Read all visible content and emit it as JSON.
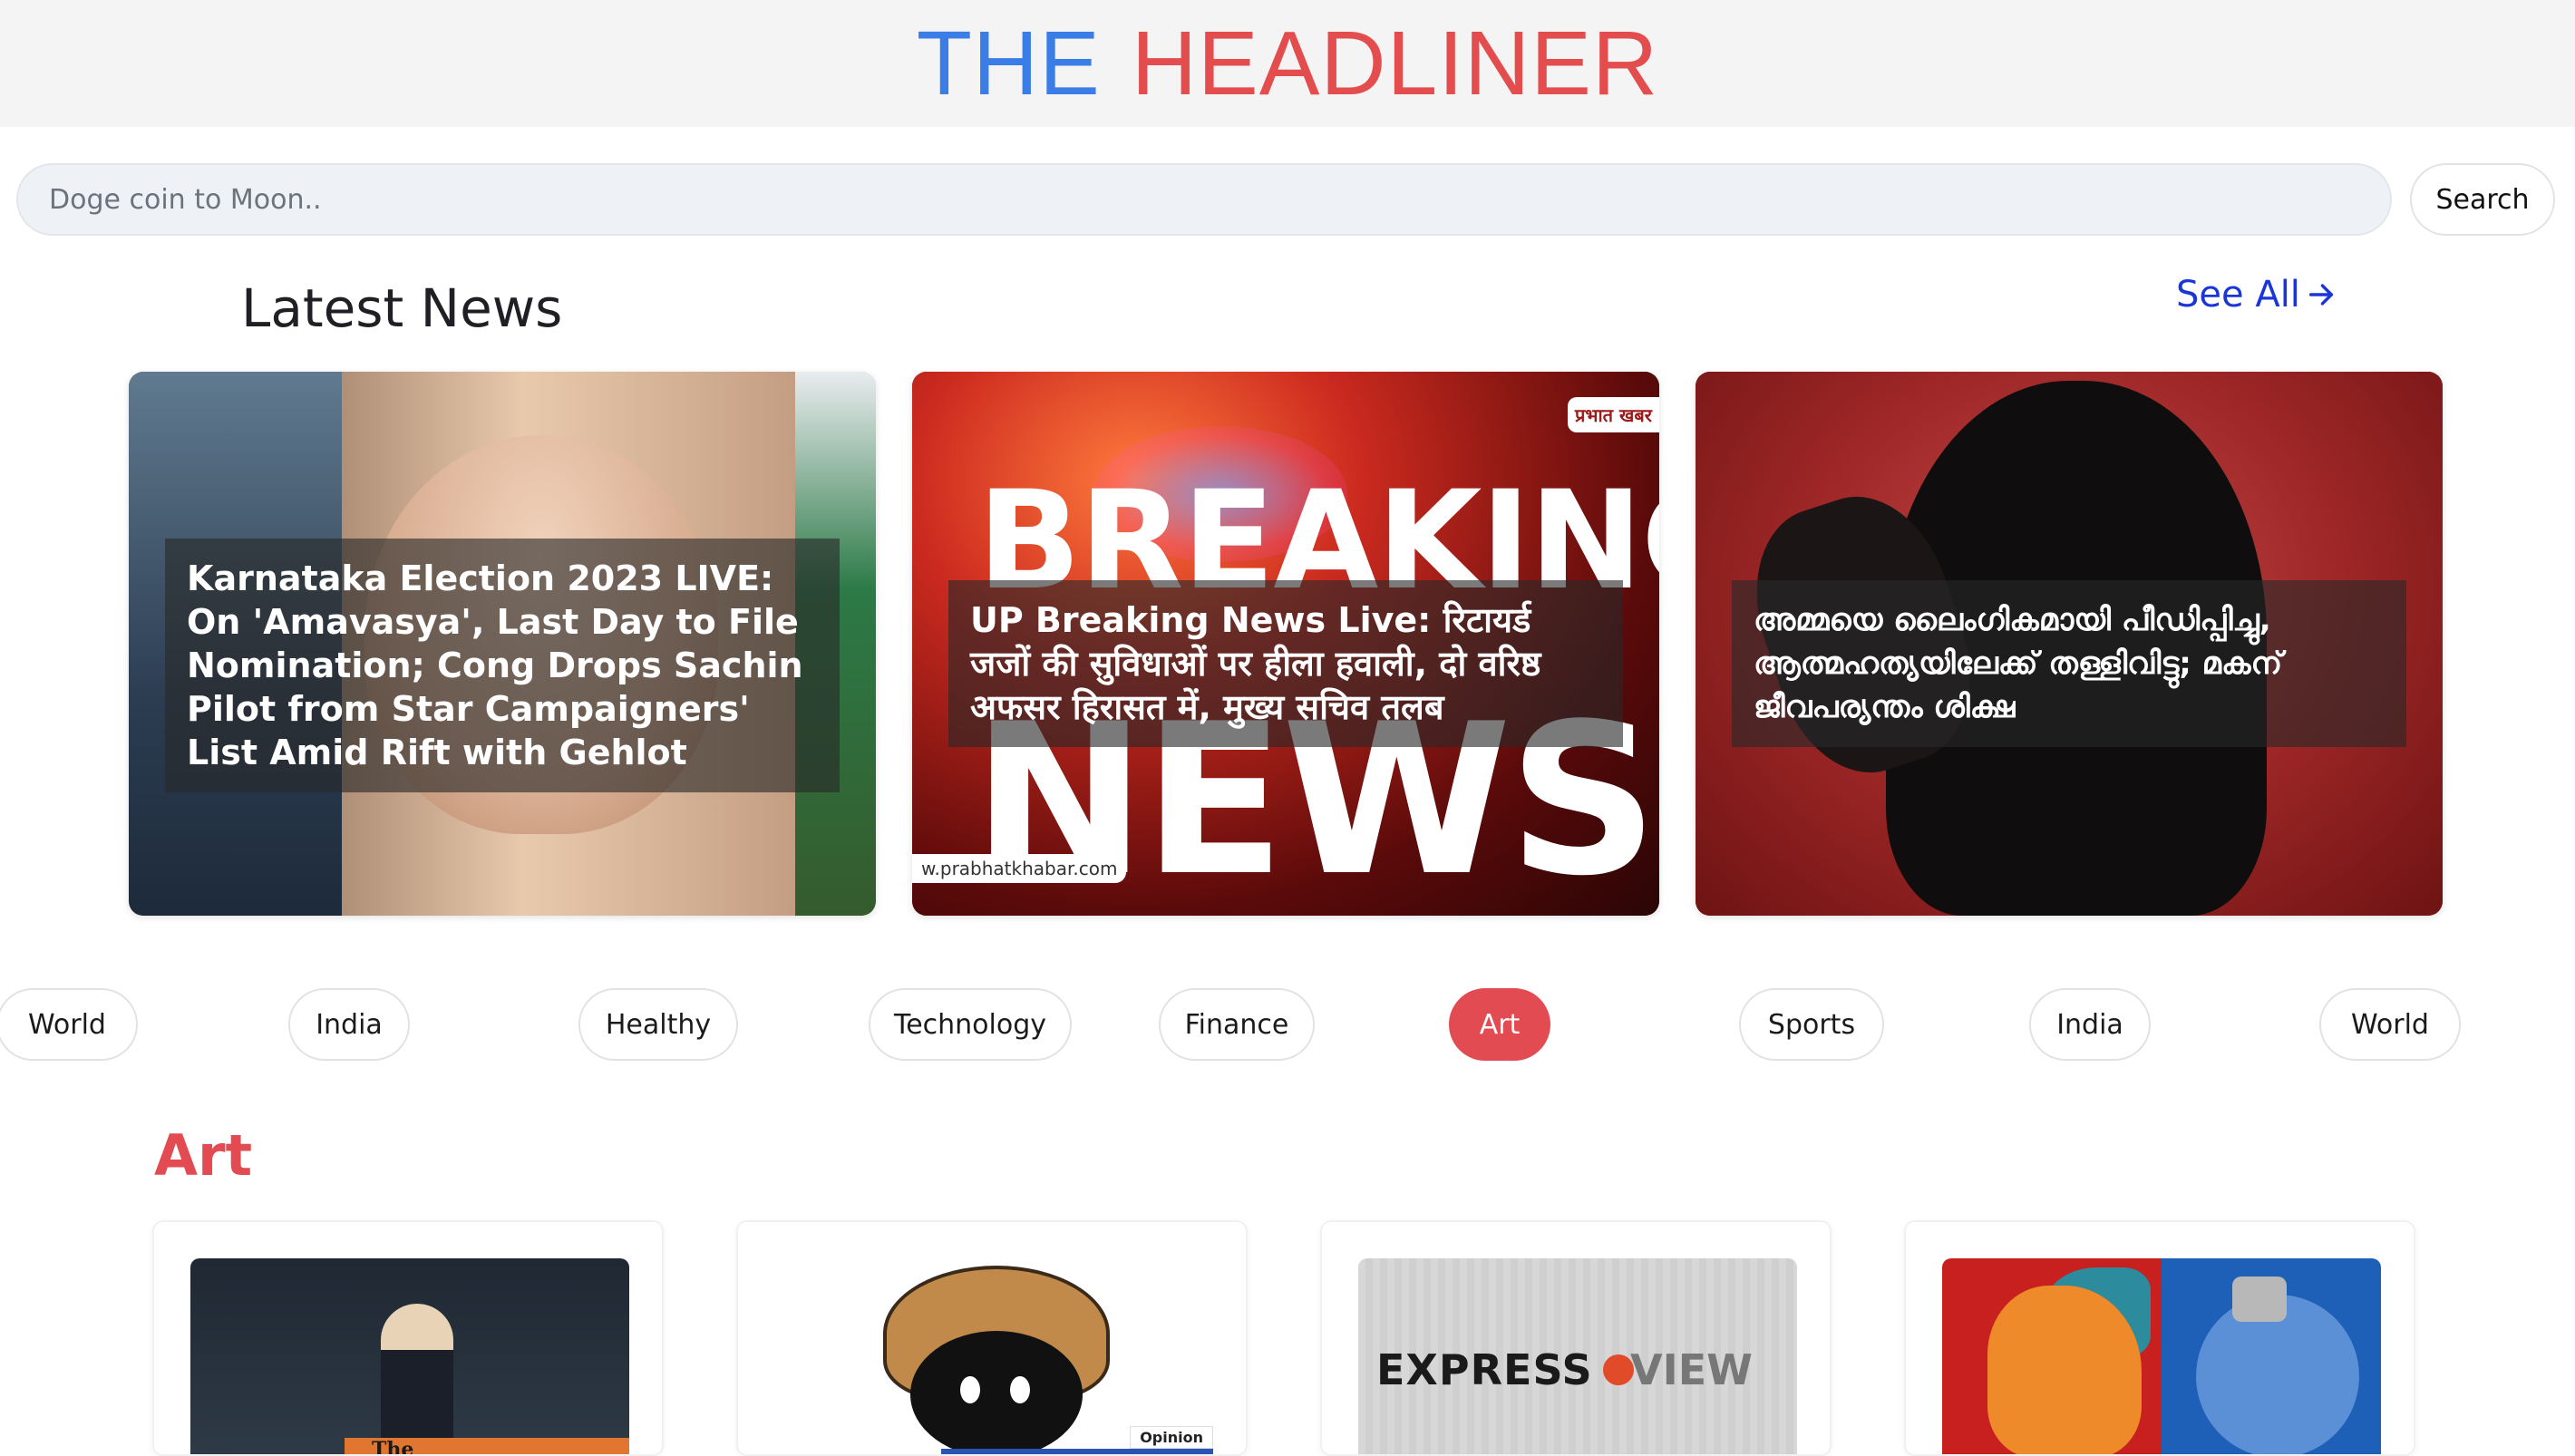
{
  "header": {
    "brand_word1": "THE",
    "brand_word2": "HEADLINER",
    "color_word1": "#3a7de6",
    "color_word2": "#e44d4d"
  },
  "search": {
    "placeholder": "Doge coin to Moon..",
    "value": "",
    "button_label": "Search"
  },
  "latest": {
    "title": "Latest News",
    "see_all_label": "See All",
    "cards": [
      {
        "caption": "Karnataka Election 2023 LIVE: On 'Amavasya', Last Day to File Nomination; Cong Drops Sachin Pilot from Star Campaigners' List Amid Rift with Gehlot"
      },
      {
        "caption": "UP Breaking News Live: रिटायर्ड जजों की सुविधाओं पर हीला हवाली, दो वरिष्ठ अफसर हिरासत में, मुख्य सचिव तलब",
        "image_text_big1": "BREAKING",
        "image_text_big2": "NEWS",
        "image_logo": "प्रभात खबर",
        "image_url": "w.prabhatkhabar.com"
      },
      {
        "caption": "അമ്മയെ ലൈംഗികമായി പീഡിപ്പിച്ചു, ആത്മഹത്യയിലേക്ക് തള്ളിവിട്ടു; മകന് ജീവപര്യന്തം ശിക്ഷ"
      }
    ]
  },
  "categories": [
    {
      "label": "World",
      "active": false
    },
    {
      "label": "India",
      "active": false
    },
    {
      "label": "Healthy",
      "active": false
    },
    {
      "label": "Technology",
      "active": false
    },
    {
      "label": "Finance",
      "active": false
    },
    {
      "label": "Art",
      "active": true
    },
    {
      "label": "Sports",
      "active": false
    },
    {
      "label": "India",
      "active": false
    },
    {
      "label": "World",
      "active": false
    }
  ],
  "section": {
    "title": "Art",
    "accent": "#e24b52"
  },
  "art_cards": [
    {
      "image_text": "The"
    },
    {
      "image_text": "Opinion"
    },
    {
      "image_text": "EXPRESS",
      "image_text2": "VIEW"
    },
    {
      "image_text": ""
    }
  ]
}
